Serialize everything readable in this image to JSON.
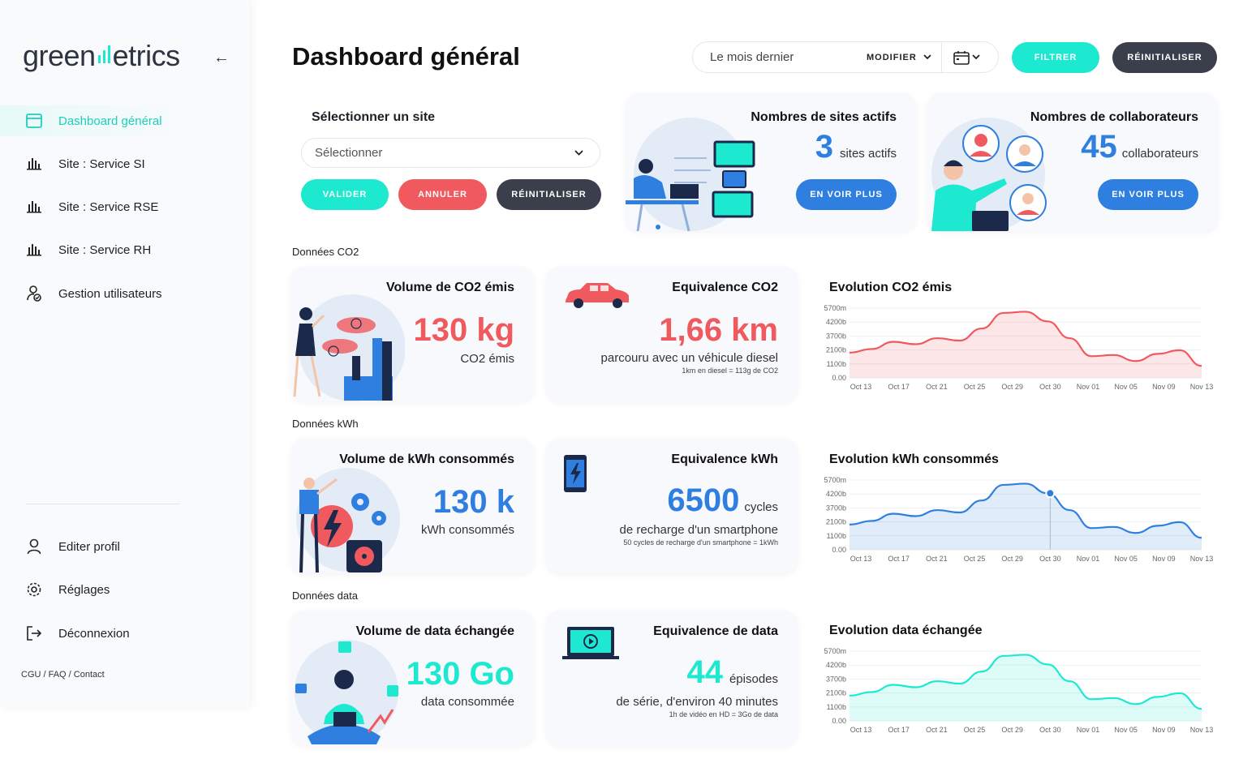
{
  "app": {
    "logo_text_pre": "green",
    "logo_text_post": "etrics"
  },
  "sidebar": {
    "items": [
      {
        "label": "Dashboard général",
        "icon": "dashboard-icon",
        "active": true
      },
      {
        "label": "Site : Service SI",
        "icon": "bar-chart-icon"
      },
      {
        "label": "Site : Service RSE",
        "icon": "bar-chart-icon"
      },
      {
        "label": "Site : Service RH",
        "icon": "bar-chart-icon"
      },
      {
        "label": "Gestion utilisateurs",
        "icon": "user-check-icon"
      }
    ],
    "bottom_items": [
      {
        "label": "Editer profil",
        "icon": "user-icon"
      },
      {
        "label": "Réglages",
        "icon": "gear-icon"
      },
      {
        "label": "Déconnexion",
        "icon": "logout-icon"
      }
    ],
    "footer": "CGU / FAQ / Contact"
  },
  "header": {
    "title": "Dashboard général",
    "period": "Le mois dernier",
    "modify": "MODIFIER",
    "filter": "FILTRER",
    "reset": "RÉINITIALISER"
  },
  "site_select": {
    "label": "Sélectionner un site",
    "placeholder": "Sélectionner",
    "validate": "VALIDER",
    "cancel": "ANNULER",
    "reset": "RÉINITIALISER"
  },
  "stats": {
    "sites": {
      "title": "Nombres de sites actifs",
      "value": "3",
      "unit": "sites actifs",
      "button": "EN VOIR PLUS"
    },
    "collab": {
      "title": "Nombres de collaborateurs",
      "value": "45",
      "unit": "collaborateurs",
      "button": "EN VOIR PLUS"
    }
  },
  "sections": {
    "co2": {
      "label": "Données CO2",
      "volume": {
        "title": "Volume de CO2 émis",
        "value": "130 kg",
        "sub": "CO2 émis"
      },
      "equiv": {
        "title": "Equivalence CO2",
        "value": "1,66 km",
        "sub": "parcouru avec un véhicule diesel",
        "note": "1km en diesel = 113g de CO2"
      },
      "chart_title": "Evolution CO2 émis"
    },
    "kwh": {
      "label": "Données kWh",
      "volume": {
        "title": "Volume de kWh consommés",
        "value": "130 k",
        "sub": "kWh consommés"
      },
      "equiv": {
        "title": "Equivalence kWh",
        "value": "6500",
        "unit": "cycles",
        "sub": "de recharge d'un smartphone",
        "note": "50 cycles de recharge d'un smartphone = 1kWh"
      },
      "chart_title": "Evolution kWh consommés"
    },
    "data": {
      "label": "Données data",
      "volume": {
        "title": "Volume de data échangée",
        "value": "130 Go",
        "sub": "data consommée"
      },
      "equiv": {
        "title": "Equivalence de data",
        "value": "44",
        "unit": "épisodes",
        "sub": "de série, d'environ 40 minutes",
        "note": "1h de vidéo en HD = 3Go de data"
      },
      "chart_title": "Evolution data échangée"
    }
  },
  "colors": {
    "teal": "#1de9d0",
    "red": "#f0595e",
    "blue": "#2f7fe0",
    "dark": "#3a3f4b"
  },
  "chart_data": [
    {
      "type": "area",
      "title": "Evolution CO2 émis",
      "x": [
        "Oct 13",
        "Oct 17",
        "Oct 21",
        "Oct 25",
        "Oct 29",
        "Oct 30",
        "Nov 01",
        "Nov 05",
        "Nov 09",
        "Nov 13"
      ],
      "y_ticks": [
        "5700m",
        "4200b",
        "3700b",
        "2100b",
        "1100b",
        "0.00"
      ],
      "series": [
        {
          "values": [
            2100,
            2400,
            3000,
            2800,
            3300,
            3100,
            4100,
            5400,
            5500,
            4700,
            3300,
            1800,
            1900,
            1400,
            2000,
            2300,
            1000
          ]
        }
      ],
      "color": "#f0595e"
    },
    {
      "type": "area",
      "title": "Evolution kWh consommés",
      "x": [
        "Oct 13",
        "Oct 17",
        "Oct 21",
        "Oct 25",
        "Oct 29",
        "Oct 30",
        "Nov 01",
        "Nov 05",
        "Nov 09",
        "Nov 13"
      ],
      "y_ticks": [
        "5700m",
        "4200b",
        "3700b",
        "2100b",
        "1100b",
        "0.00"
      ],
      "series": [
        {
          "values": [
            2100,
            2400,
            3000,
            2800,
            3300,
            3100,
            4100,
            5400,
            5500,
            4700,
            3300,
            1800,
            1900,
            1400,
            2000,
            2300,
            1000
          ]
        }
      ],
      "highlight": {
        "x": "Oct 30"
      },
      "color": "#2f7fe0"
    },
    {
      "type": "area",
      "title": "Evolution data échangée",
      "x": [
        "Oct 13",
        "Oct 17",
        "Oct 21",
        "Oct 25",
        "Oct 29",
        "Oct 30",
        "Nov 01",
        "Nov 05",
        "Nov 09",
        "Nov 13"
      ],
      "y_ticks": [
        "5700m",
        "4200b",
        "3700b",
        "2100b",
        "1100b",
        "0.00"
      ],
      "series": [
        {
          "values": [
            2100,
            2400,
            3000,
            2800,
            3300,
            3100,
            4100,
            5400,
            5500,
            4700,
            3300,
            1800,
            1900,
            1400,
            2000,
            2300,
            1000
          ]
        }
      ],
      "color": "#1de9d0"
    }
  ]
}
